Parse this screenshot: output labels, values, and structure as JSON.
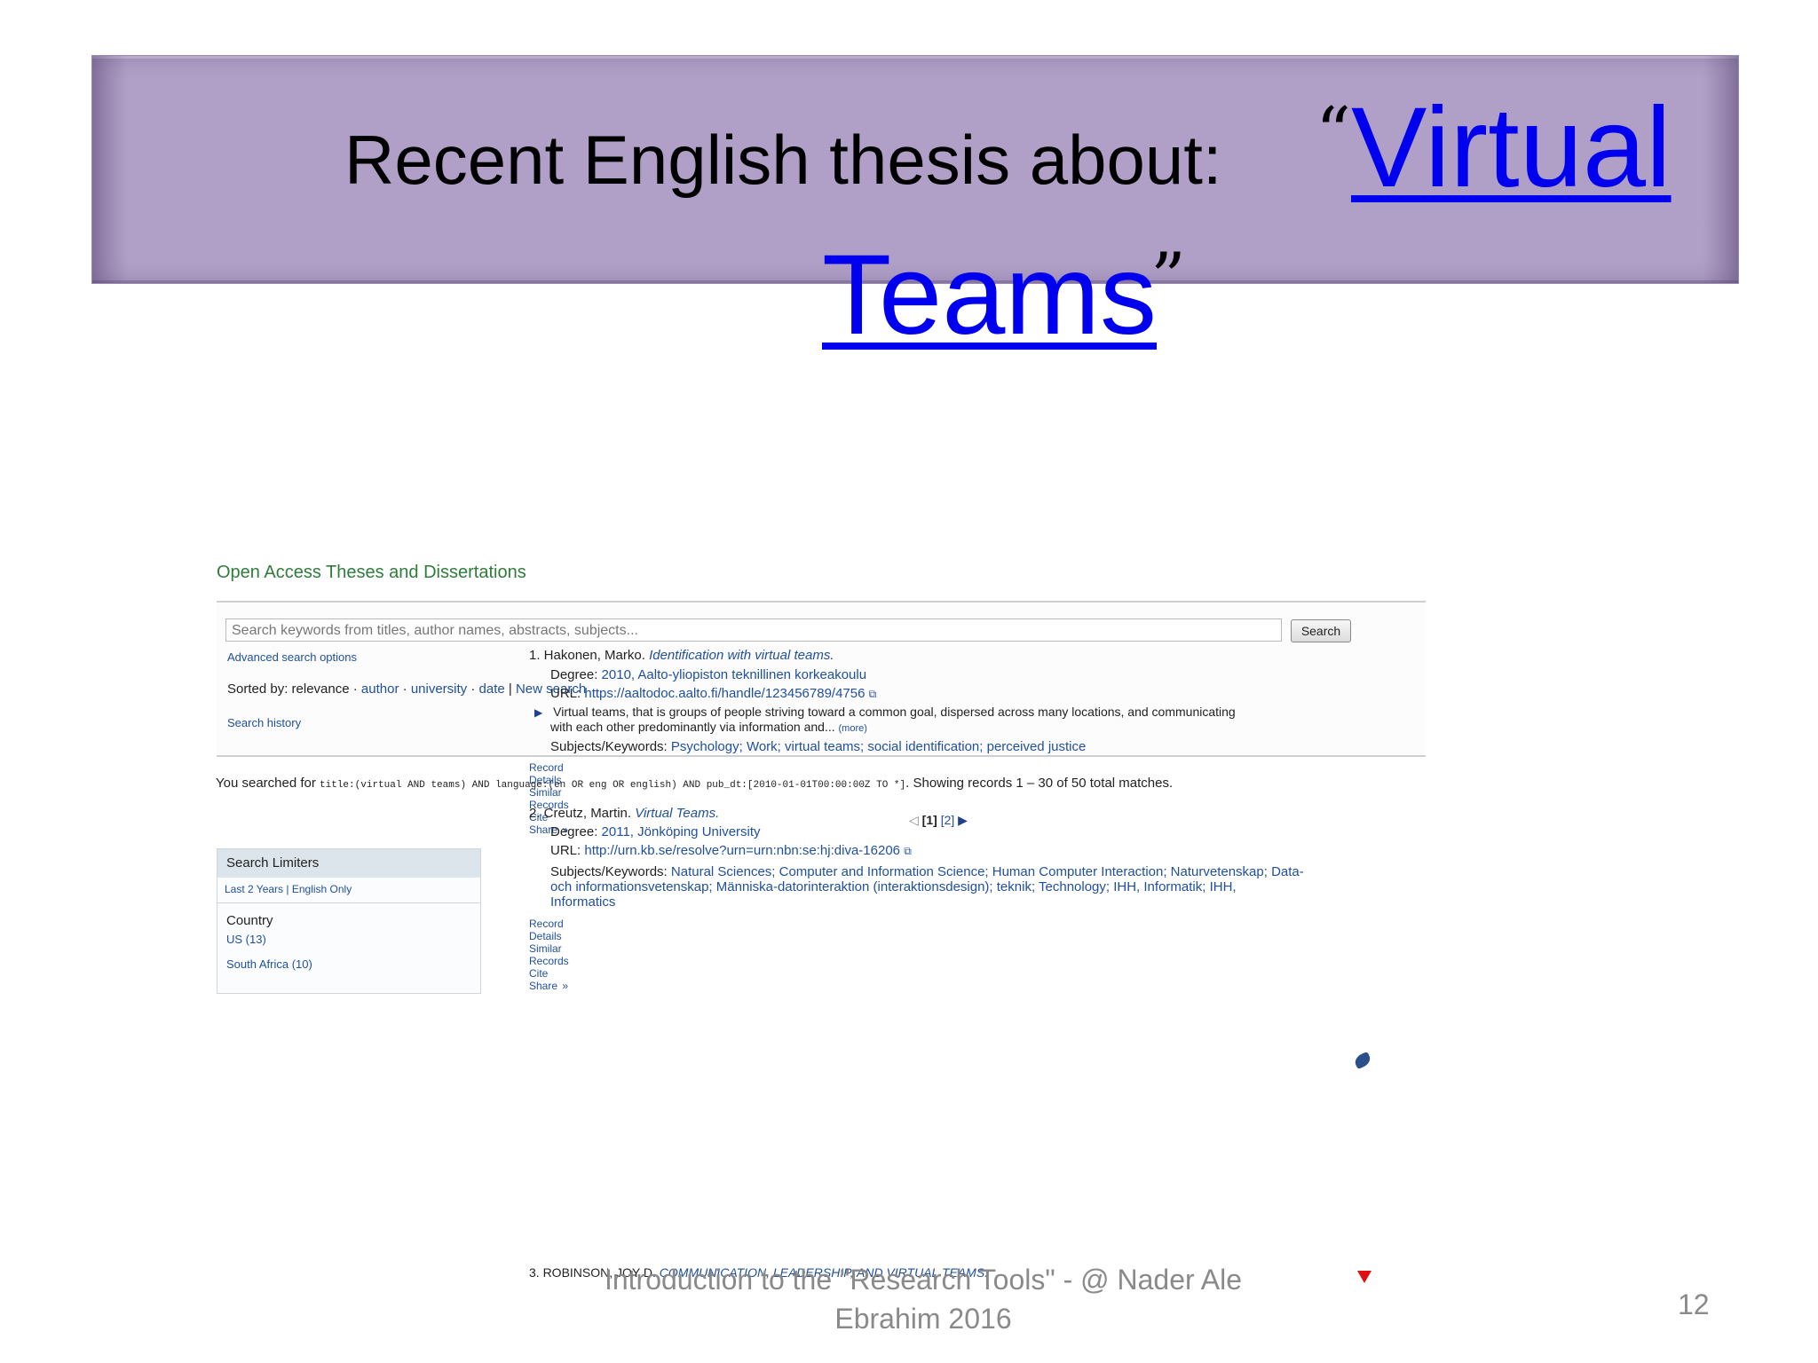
{
  "slide": {
    "title_lead": "Recent English thesis about:",
    "open_quote": "“",
    "link_word1": "Virtual",
    "link_word2": "Teams",
    "close_quote": "”",
    "footer_line1": "Introduction to the \"Research Tools\" - @ Nader Ale",
    "footer_line2": "Ebrahim 2016",
    "page_number": "12"
  },
  "screenshot": {
    "header": "Open Access Theses and Dissertations",
    "search": {
      "placeholder": "Search keywords from titles, author names, abstracts, subjects...",
      "button": "Search",
      "advanced": "Advanced search options"
    },
    "sorted_by": {
      "label": "Sorted by: relevance ·",
      "author": "author",
      "sep1": "·",
      "university": "university",
      "sep2": "·",
      "date": "date",
      "sep3": "|",
      "new_search": "New search"
    },
    "search_history": "Search history",
    "query": {
      "prefix": "You searched for",
      "code": "title:(virtual AND teams) AND language:(en OR eng OR english) AND pub_dt:[2010-01-01T00:00:00Z TO *]",
      "suffix": ". Showing records 1 – 30 of 50 total matches."
    },
    "pager": {
      "prev": "◁",
      "page1": "[1]",
      "page2": "[2]",
      "next": "▶"
    },
    "limiters": {
      "header": "Search Limiters",
      "sub": "Last 2 Years | English Only",
      "country_label": "Country",
      "us": "US (13)",
      "south_africa": "South Africa (10)"
    },
    "records": [
      {
        "head": "1. Hakonen, Marko.",
        "title": "Identification with virtual teams.",
        "degree_label": "Degree:",
        "degree": "2010, Aalto-yliopiston teknillinen korkeakoulu",
        "url_label": "URL:",
        "url": "https://aaltodoc.aalto.fi/handle/123456789/4756",
        "abstract1": "Virtual teams, that is groups of people striving toward a common goal, dispersed across many locations, and communicating",
        "abstract2": "with each other predominantly via information and...",
        "more": "(more)",
        "subjects_label": "Subjects/Keywords:",
        "subjects": "Psychology; Work; virtual teams; social identification; perceived justice"
      },
      {
        "head": "2. Creutz, Martin.",
        "title": "Virtual Teams.",
        "degree_label": "Degree:",
        "degree": "2011, Jönköping University",
        "url_label": "URL:",
        "url": "http://urn.kb.se/resolve?urn=urn:nbn:se:hj:diva-16206",
        "subjects_label": "Subjects/Keywords:",
        "subjects1": "Natural Sciences; Computer and Information Science; Human Computer Interaction; Naturvetenskap; Data-",
        "subjects2": "och informationsvetenskap; Människa-datorinteraktion (interaktionsdesign); teknik; Technology; IHH, Informatik; IHH,",
        "subjects3": "Informatics"
      },
      {
        "head": "3. ROBINSON, JOY D.",
        "title": "COMMUNICATION, LEADERSHIP, AND VIRTUAL TEAMS."
      }
    ],
    "actions": {
      "details": "Record Details",
      "similar": "Similar Records",
      "cite": "Cite",
      "share": "Share »"
    }
  },
  "icons": {
    "external_link": "external-link-icon",
    "expand": "expand-triangle-icon",
    "record_type_blue": "feather-icon",
    "record_type_red": "pdf-icon"
  }
}
